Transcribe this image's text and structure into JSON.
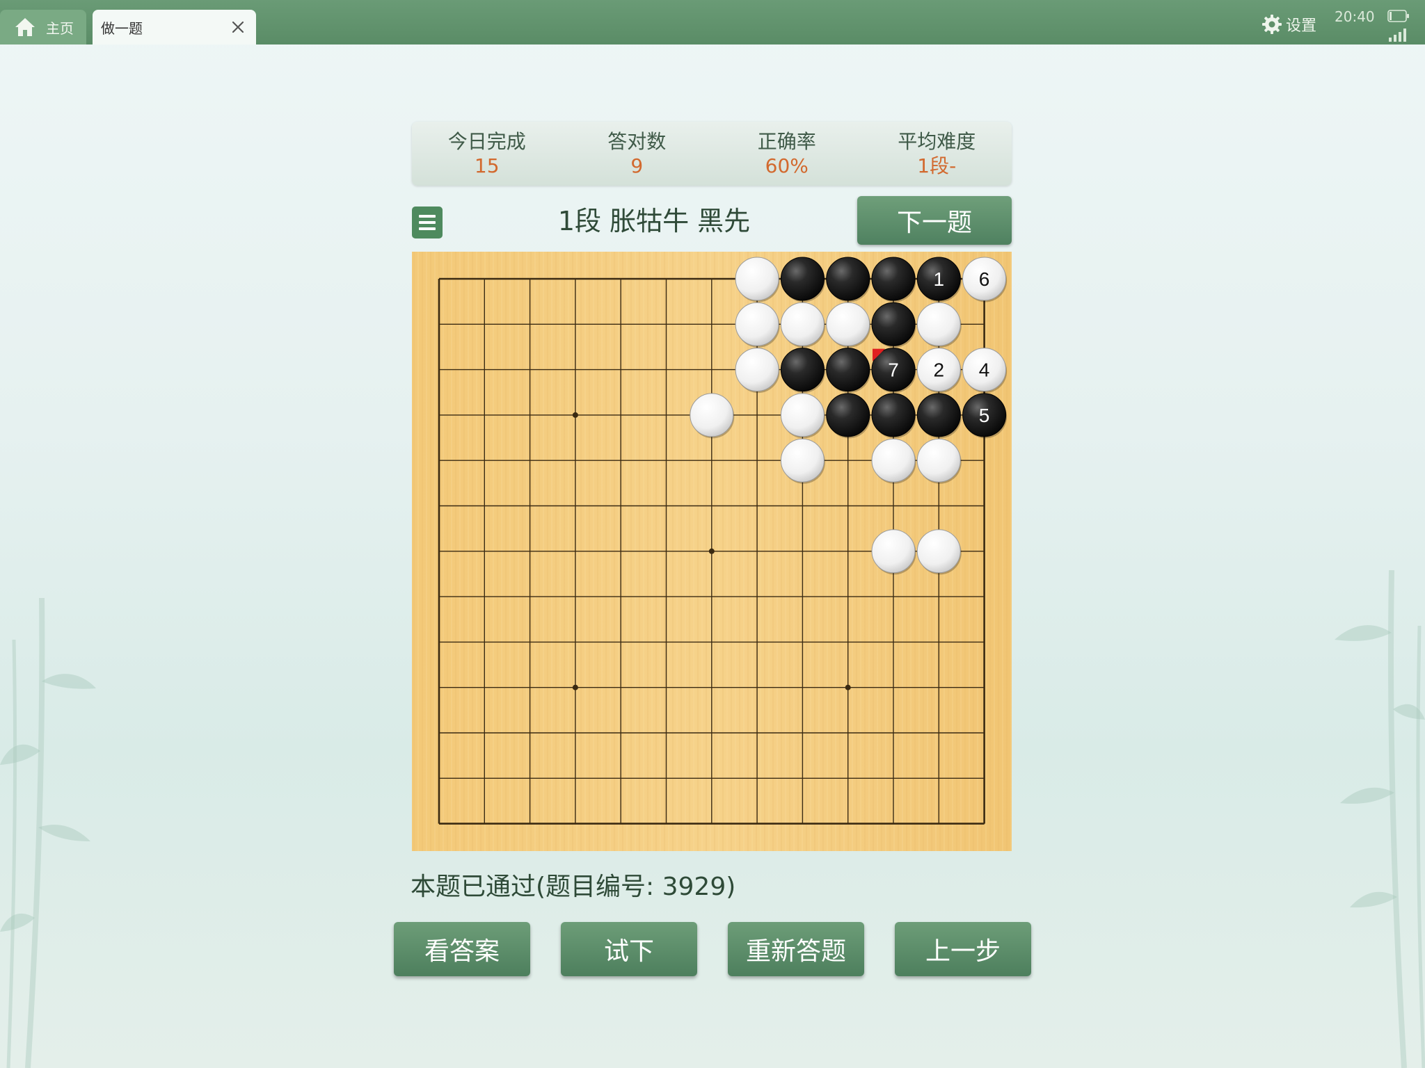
{
  "top_bar": {
    "home_tab_label": "主页",
    "active_tab_label": "做一题",
    "settings_label": "设置",
    "time": "20:40"
  },
  "stats": [
    {
      "label": "今日完成",
      "value": "15"
    },
    {
      "label": "答对数",
      "value": "9"
    },
    {
      "label": "正确率",
      "value": "60%"
    },
    {
      "label": "平均难度",
      "value": "1段-"
    }
  ],
  "problem": {
    "title": "1段 胀牯牛 黑先",
    "next_label": "下一题"
  },
  "board": {
    "rows": 13,
    "cols": 13,
    "star_points": [
      [
        3,
        3
      ],
      [
        3,
        9
      ],
      [
        6,
        6
      ],
      [
        9,
        3
      ],
      [
        9,
        9
      ]
    ],
    "last_move_marker": [
      2,
      10
    ],
    "stones": [
      {
        "row": 0,
        "col": 7,
        "color": "white"
      },
      {
        "row": 0,
        "col": 8,
        "color": "black"
      },
      {
        "row": 0,
        "col": 9,
        "color": "black"
      },
      {
        "row": 0,
        "col": 10,
        "color": "black"
      },
      {
        "row": 0,
        "col": 11,
        "color": "black",
        "label": "1"
      },
      {
        "row": 0,
        "col": 12,
        "color": "white",
        "label": "6"
      },
      {
        "row": 1,
        "col": 7,
        "color": "white"
      },
      {
        "row": 1,
        "col": 8,
        "color": "white"
      },
      {
        "row": 1,
        "col": 9,
        "color": "white"
      },
      {
        "row": 1,
        "col": 10,
        "color": "black"
      },
      {
        "row": 1,
        "col": 11,
        "color": "white"
      },
      {
        "row": 2,
        "col": 7,
        "color": "white"
      },
      {
        "row": 2,
        "col": 8,
        "color": "black"
      },
      {
        "row": 2,
        "col": 9,
        "color": "black"
      },
      {
        "row": 2,
        "col": 10,
        "color": "black",
        "label": "7"
      },
      {
        "row": 2,
        "col": 11,
        "color": "white",
        "label": "2"
      },
      {
        "row": 2,
        "col": 12,
        "color": "white",
        "label": "4"
      },
      {
        "row": 3,
        "col": 6,
        "color": "white"
      },
      {
        "row": 3,
        "col": 8,
        "color": "white"
      },
      {
        "row": 3,
        "col": 9,
        "color": "black"
      },
      {
        "row": 3,
        "col": 10,
        "color": "black"
      },
      {
        "row": 3,
        "col": 11,
        "color": "black"
      },
      {
        "row": 3,
        "col": 12,
        "color": "black",
        "label": "5"
      },
      {
        "row": 4,
        "col": 8,
        "color": "white"
      },
      {
        "row": 4,
        "col": 10,
        "color": "white"
      },
      {
        "row": 4,
        "col": 11,
        "color": "white"
      },
      {
        "row": 6,
        "col": 10,
        "color": "white"
      },
      {
        "row": 6,
        "col": 11,
        "color": "white"
      }
    ]
  },
  "status": "本题已通过(题目编号: 3929)",
  "actions": [
    "看答案",
    "试下",
    "重新答题",
    "上一步"
  ]
}
